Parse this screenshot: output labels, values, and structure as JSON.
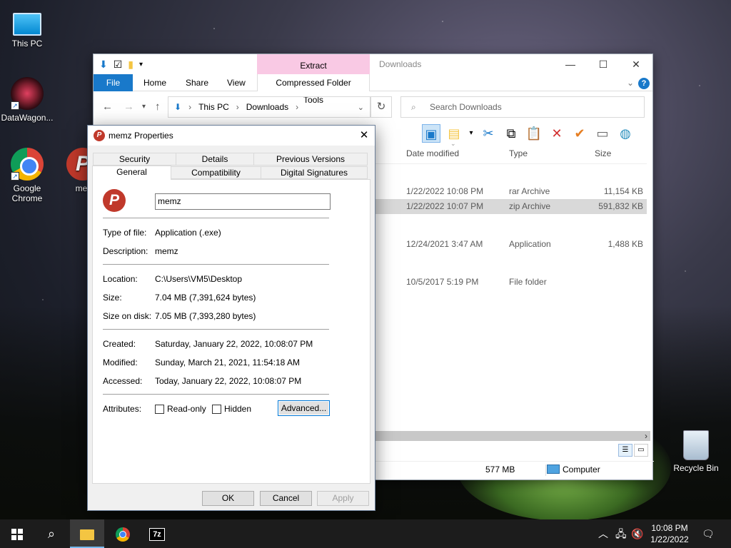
{
  "desktop": {
    "icons": [
      {
        "label": "This PC"
      },
      {
        "label": "DataWagon..."
      },
      {
        "label": "Google Chrome"
      },
      {
        "label": "mer"
      },
      {
        "label": "Recycle Bin"
      }
    ]
  },
  "explorer": {
    "title": "Downloads",
    "context_tab": "Extract",
    "ribbon_tabs": [
      "File",
      "Home",
      "Share",
      "View",
      "Compressed Folder Tools"
    ],
    "breadcrumb": [
      "This PC",
      "Downloads"
    ],
    "search_placeholder": "Search Downloads",
    "columns": [
      "Date modified",
      "Type",
      "Size"
    ],
    "rows": [
      {
        "date": "1/22/2022 10:08 PM",
        "type": "rar Archive",
        "size": "11,154 KB",
        "selected": false
      },
      {
        "date": "1/22/2022 10:07 PM",
        "type": "zip Archive",
        "size": "591,832 KB",
        "selected": true
      },
      {
        "date": "12/24/2021 3:47 AM",
        "type": "Application",
        "size": "1,488 KB",
        "selected": false
      },
      {
        "date": "10/5/2017 5:19 PM",
        "type": "File folder",
        "size": "",
        "selected": false
      }
    ],
    "status": {
      "free": "577 MB",
      "location": "Computer"
    }
  },
  "props": {
    "title": "memz Properties",
    "tabs_row1": [
      "Security",
      "Details",
      "Previous Versions"
    ],
    "tabs_row2": [
      "General",
      "Compatibility",
      "Digital Signatures"
    ],
    "name": "memz",
    "fields": {
      "type_label": "Type of file:",
      "type_value": "Application (.exe)",
      "desc_label": "Description:",
      "desc_value": "memz",
      "loc_label": "Location:",
      "loc_value": "C:\\Users\\VM5\\Desktop",
      "size_label": "Size:",
      "size_value": "7.04 MB (7,391,624 bytes)",
      "disk_label": "Size on disk:",
      "disk_value": "7.05 MB (7,393,280 bytes)",
      "created_label": "Created:",
      "created_value": "Saturday, January 22, 2022, 10:08:07 PM",
      "modified_label": "Modified:",
      "modified_value": "Sunday, March 21, 2021, 11:54:18 AM",
      "accessed_label": "Accessed:",
      "accessed_value": "Today, January 22, 2022, 10:08:07 PM",
      "attr_label": "Attributes:"
    },
    "readonly_label": "Read-only",
    "hidden_label": "Hidden",
    "advanced_label": "Advanced...",
    "ok_label": "OK",
    "cancel_label": "Cancel",
    "apply_label": "Apply"
  },
  "taskbar": {
    "time": "10:08 PM",
    "date": "1/22/2022",
    "seven_zip": "7z"
  }
}
